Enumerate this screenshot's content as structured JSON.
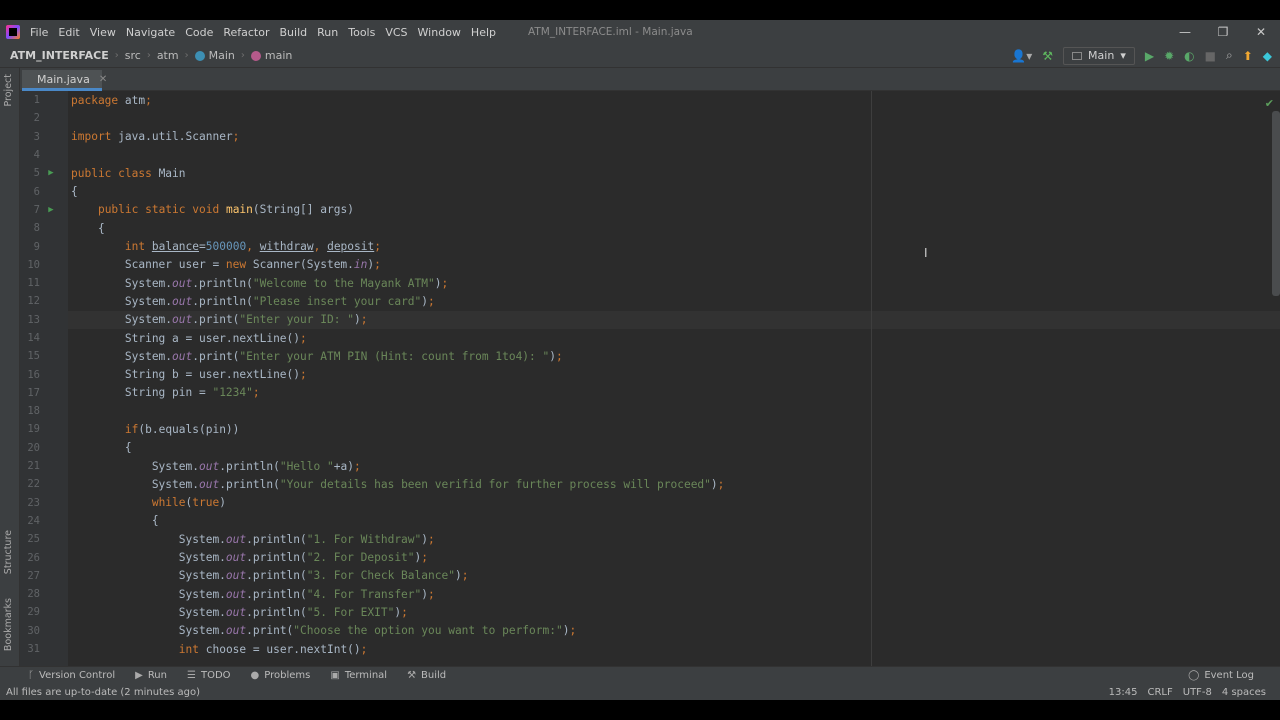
{
  "menubar": {
    "items": [
      "File",
      "Edit",
      "View",
      "Navigate",
      "Code",
      "Refactor",
      "Build",
      "Run",
      "Tools",
      "VCS",
      "Window",
      "Help"
    ],
    "title": "ATM_INTERFACE.iml - Main.java"
  },
  "breadcrumb": {
    "project": "ATM_INTERFACE",
    "folder1": "src",
    "folder2": "atm",
    "class": "Main",
    "method": "main"
  },
  "run_config": {
    "label": "Main"
  },
  "left_tool_windows": {
    "project": "Project",
    "structure": "Structure",
    "bookmarks": "Bookmarks"
  },
  "tab": {
    "label": "Main.java"
  },
  "code_lines": [
    {
      "n": "1",
      "html": "<span class=\"k\">package</span> atm<span class=\"k\">;</span>"
    },
    {
      "n": "2",
      "html": ""
    },
    {
      "n": "3",
      "html": "<span class=\"k\">import</span> java.util.Scanner<span class=\"k\">;</span>"
    },
    {
      "n": "4",
      "html": ""
    },
    {
      "n": "5",
      "run": true,
      "html": "<span class=\"k\">public class</span> Main"
    },
    {
      "n": "6",
      "html": "{"
    },
    {
      "n": "7",
      "run": true,
      "html": "    <span class=\"k\">public static void</span> <span class=\"m\">main</span>(String[] args)"
    },
    {
      "n": "8",
      "html": "    {"
    },
    {
      "n": "9",
      "html": "        <span class=\"k\">int</span> <span class=\"u\">balance</span>=<span class=\"n\">500000</span><span class=\"k\">,</span> <span class=\"u\">withdraw</span><span class=\"k\">,</span> <span class=\"u\">deposit</span><span class=\"k\">;</span>"
    },
    {
      "n": "10",
      "html": "        Scanner user = <span class=\"k\">new</span> Scanner(System.<span class=\"f\">in</span>)<span class=\"k\">;</span>"
    },
    {
      "n": "11",
      "html": "        System.<span class=\"f\">out</span>.println(<span class=\"s\">\"Welcome to the Mayank ATM\"</span>)<span class=\"k\">;</span>"
    },
    {
      "n": "12",
      "html": "        System.<span class=\"f\">out</span>.println(<span class=\"s\">\"Please insert your card\"</span>)<span class=\"k\">;</span>"
    },
    {
      "n": "13",
      "html": "        System.<span class=\"f\">out</span>.print(<span class=\"s\">\"Enter your ID: \"</span>)<span class=\"k\">;</span>"
    },
    {
      "n": "14",
      "html": "        String a = user.nextLine()<span class=\"k\">;</span>"
    },
    {
      "n": "15",
      "html": "        System.<span class=\"f\">out</span>.print(<span class=\"s\">\"Enter your ATM PIN (Hint: count from 1to4): \"</span>)<span class=\"k\">;</span>"
    },
    {
      "n": "16",
      "html": "        String b = user.nextLine()<span class=\"k\">;</span>"
    },
    {
      "n": "17",
      "html": "        String pin = <span class=\"s\">\"1234\"</span><span class=\"k\">;</span>"
    },
    {
      "n": "18",
      "html": ""
    },
    {
      "n": "19",
      "html": "        <span class=\"k\">if</span>(b.equals(pin))"
    },
    {
      "n": "20",
      "html": "        {"
    },
    {
      "n": "21",
      "html": "            System.<span class=\"f\">out</span>.println(<span class=\"s\">\"Hello \"</span>+a)<span class=\"k\">;</span>"
    },
    {
      "n": "22",
      "html": "            System.<span class=\"f\">out</span>.println(<span class=\"s\">\"Your details has been verifid for further process will proceed\"</span>)<span class=\"k\">;</span>"
    },
    {
      "n": "23",
      "html": "            <span class=\"k\">while</span>(<span class=\"k\">true</span>)"
    },
    {
      "n": "24",
      "html": "            {"
    },
    {
      "n": "25",
      "html": "                System.<span class=\"f\">out</span>.println(<span class=\"s\">\"1. For Withdraw\"</span>)<span class=\"k\">;</span>"
    },
    {
      "n": "26",
      "html": "                System.<span class=\"f\">out</span>.println(<span class=\"s\">\"2. For Deposit\"</span>)<span class=\"k\">;</span>"
    },
    {
      "n": "27",
      "html": "                System.<span class=\"f\">out</span>.println(<span class=\"s\">\"3. For Check Balance\"</span>)<span class=\"k\">;</span>"
    },
    {
      "n": "28",
      "html": "                System.<span class=\"f\">out</span>.println(<span class=\"s\">\"4. For Transfer\"</span>)<span class=\"k\">;</span>"
    },
    {
      "n": "29",
      "html": "                System.<span class=\"f\">out</span>.println(<span class=\"s\">\"5. For EXIT\"</span>)<span class=\"k\">;</span>"
    },
    {
      "n": "30",
      "html": "                System.<span class=\"f\">out</span>.print(<span class=\"s\">\"Choose the option you want to perform:\"</span>)<span class=\"k\">;</span>"
    },
    {
      "n": "31",
      "html": "                <span class=\"k\">int</span> choose = user.nextInt()<span class=\"k\">;</span>"
    }
  ],
  "tool_windows": {
    "version_control": "Version Control",
    "run": "Run",
    "todo": "TODO",
    "problems": "Problems",
    "terminal": "Terminal",
    "build": "Build",
    "event_log": "Event Log"
  },
  "status": {
    "message": "All files are up-to-date (2 minutes ago)",
    "position": "13:45",
    "line_sep": "CRLF",
    "encoding": "UTF-8",
    "indent": "4 spaces"
  }
}
